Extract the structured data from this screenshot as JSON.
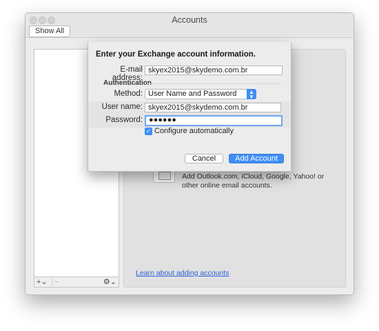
{
  "window": {
    "title": "Accounts",
    "show_all_label": "Show All"
  },
  "left_pane": {
    "add_label": "+⌄",
    "remove_label": "−",
    "gear_label": "⚙⌄"
  },
  "right_pane": {
    "description": "Add Outlook.com, iCloud, Google, Yahoo! or other online email accounts.",
    "learn_link": "Learn about adding accounts"
  },
  "sheet": {
    "title": "Enter your Exchange account information.",
    "email_label": "E-mail address:",
    "email_value": "skyex2015@skydemo.com.br",
    "auth_section": "Authentication",
    "method_label": "Method:",
    "method_value": "User Name and Password",
    "username_label": "User name:",
    "username_value": "skyex2015@skydemo.com.br",
    "password_label": "Password:",
    "password_value": "●●●●●●",
    "configure_label": "Configure automatically",
    "configure_checked": true,
    "cancel_label": "Cancel",
    "add_label": "Add Account"
  },
  "colors": {
    "accent": "#3f8ef5",
    "link": "#2b5fd6"
  }
}
